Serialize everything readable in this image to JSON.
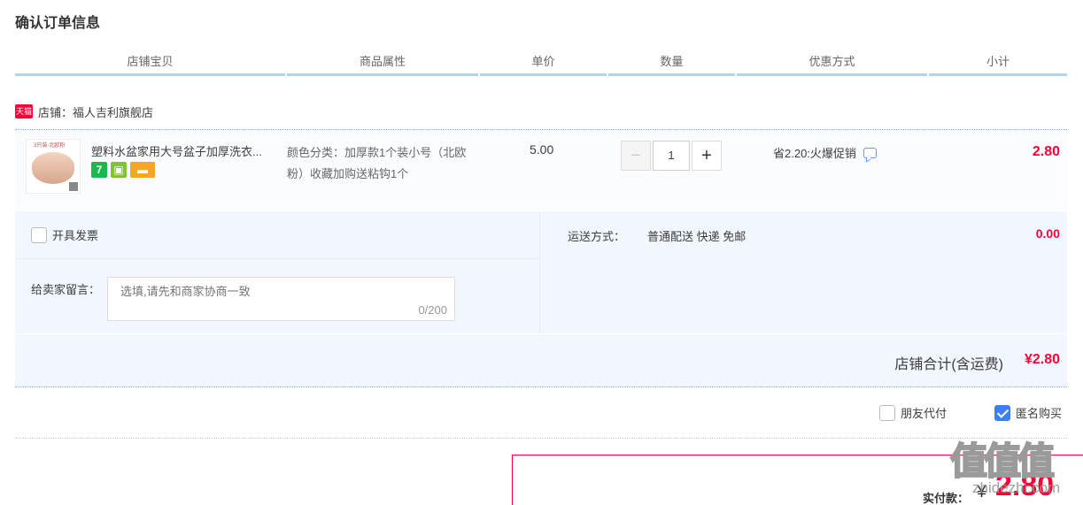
{
  "page": {
    "title": "确认订单信息"
  },
  "columns": [
    "店铺宝贝",
    "商品属性",
    "单价",
    "数量",
    "优惠方式",
    "小计"
  ],
  "shop": {
    "badge": "天猫",
    "label": "店铺：福人吉利旗舰店"
  },
  "item": {
    "title": "塑料水盆家用大号盆子加厚洗衣...",
    "thumb_caption": "3只装·北欧粉",
    "attributes": "颜色分类：加厚款1个装小号（北欧粉）收藏加购送粘钩1个",
    "unit_price": "5.00",
    "quantity": "1",
    "minus": "−",
    "plus": "+",
    "badge_7": "7",
    "promotion": "省2.20:火爆促销",
    "subtotal": "2.80"
  },
  "invoice": {
    "label": "开具发票"
  },
  "message": {
    "label": "给卖家留言：",
    "placeholder": "选填,请先和商家协商一致",
    "count": "0/200"
  },
  "shipping": {
    "label": "运送方式：",
    "method": "普通配送 快递 免邮",
    "fee": "0.00"
  },
  "shop_total": {
    "label": "店铺合计(含运费)",
    "value": "¥2.80"
  },
  "extras": {
    "friend_pay": "朋友代付",
    "anonymous": "匿名购买"
  },
  "payment": {
    "label": "实付款：",
    "currency": "¥",
    "amount": "2.80"
  },
  "watermark": {
    "main": "值值值",
    "sub": "zhidezhi.com"
  },
  "colors": {
    "accent": "#ff0036",
    "header_rule": "#b2d1ff",
    "panel_bg": "#f2f7ff",
    "checkbox_on": "#3c7ff5"
  }
}
